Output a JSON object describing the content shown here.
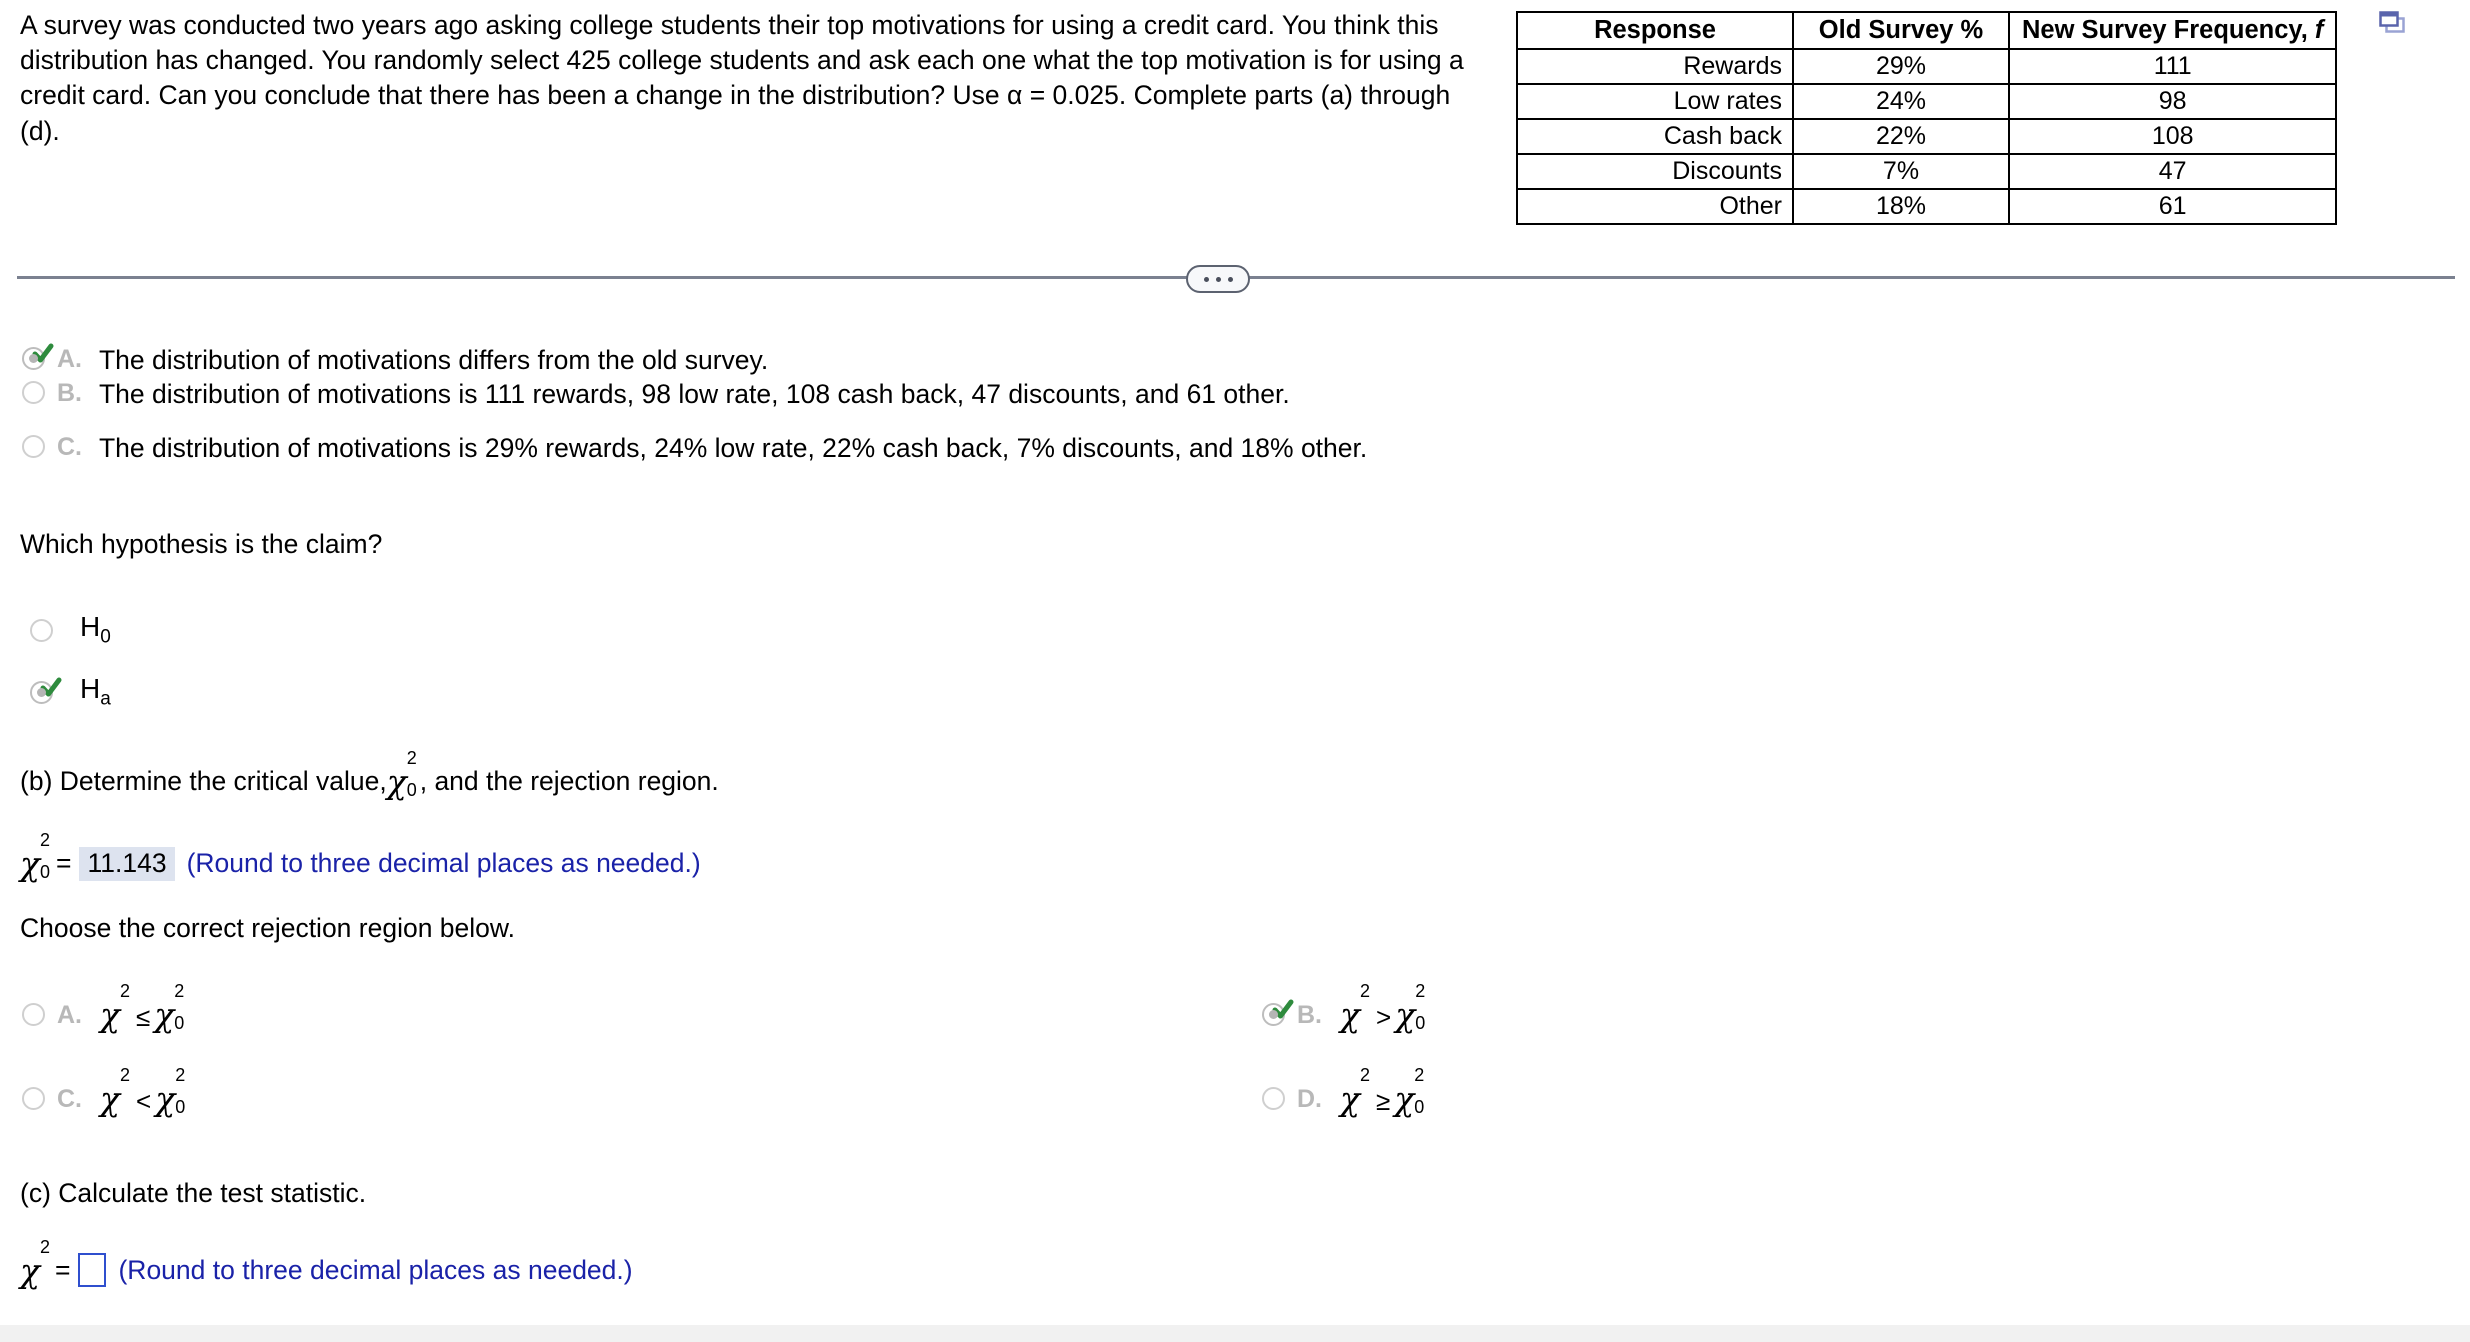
{
  "problem": {
    "statement": "A survey was conducted two years ago asking college students their top motivations for using a credit card. You think this distribution has changed. You randomly select 425 college students and ask each one what the top motivation is for using a credit card. Can you conclude that there has been a change in the distribution? Use α = 0.025. Complete parts (a) through (d)."
  },
  "table": {
    "headers": [
      "Response",
      "Old Survey %",
      "New Survey  Frequency, "
    ],
    "header_italic_suffix": "f",
    "rows": [
      {
        "response": "Rewards",
        "old_pct": "29%",
        "new_freq": "111"
      },
      {
        "response": "Low rates",
        "old_pct": "24%",
        "new_freq": "98"
      },
      {
        "response": "Cash back",
        "old_pct": "22%",
        "new_freq": "108"
      },
      {
        "response": "Discounts",
        "old_pct": "7%",
        "new_freq": "47"
      },
      {
        "response": "Other",
        "old_pct": "18%",
        "new_freq": "61"
      }
    ],
    "copy_icon": "copy-icon"
  },
  "divider": {
    "expand_icon": "ellipsis-icon"
  },
  "part_a": {
    "options": [
      {
        "letter": "A.",
        "text": "The distribution of motivations differs from the old survey.",
        "selected": true
      },
      {
        "letter": "B.",
        "text": "The distribution of motivations is 111 rewards, 98 low rate, 108 cash back, 47 discounts, and 61 other.",
        "selected": false
      },
      {
        "letter": "C.",
        "text": "The distribution of motivations is 29% rewards, 24% low rate, 22% cash back, 7% discounts, and 18% other.",
        "selected": false
      }
    ]
  },
  "hypothesis": {
    "question": "Which hypothesis is the claim?",
    "options": [
      {
        "label_base": "H",
        "label_sub": "0",
        "selected": false
      },
      {
        "label_base": "H",
        "label_sub": "a",
        "selected": true
      }
    ]
  },
  "part_b": {
    "prompt_before": "(b) Determine the critical value, ",
    "prompt_after": ", and the rejection region.",
    "chi_symbol": "χ",
    "chi_sup": "2",
    "chi_sub": "0",
    "equals": "=",
    "critical_value": "11.143",
    "hint": "(Round to three decimal places as needed.)",
    "region_prompt": "Choose the correct rejection region below.",
    "region_options": [
      {
        "letter": "A.",
        "operator": "≤",
        "selected": false
      },
      {
        "letter": "B.",
        "operator": ">",
        "selected": true
      },
      {
        "letter": "C.",
        "operator": "<",
        "selected": false
      },
      {
        "letter": "D.",
        "operator": "≥",
        "selected": false
      }
    ]
  },
  "part_c": {
    "prompt": "(c) Calculate the test statistic.",
    "chi_symbol": "χ",
    "chi_sup": "2",
    "equals": "=",
    "value": "",
    "hint": "(Round to three decimal places as needed.)"
  },
  "colors": {
    "answer_fill": "#dde3ef",
    "hint_blue": "#1a22a8",
    "input_border": "#2f4fce",
    "check_green": "#2e8b3d",
    "divider_gray": "#7b8190",
    "copy_icon_blue": "#6a74b8"
  }
}
